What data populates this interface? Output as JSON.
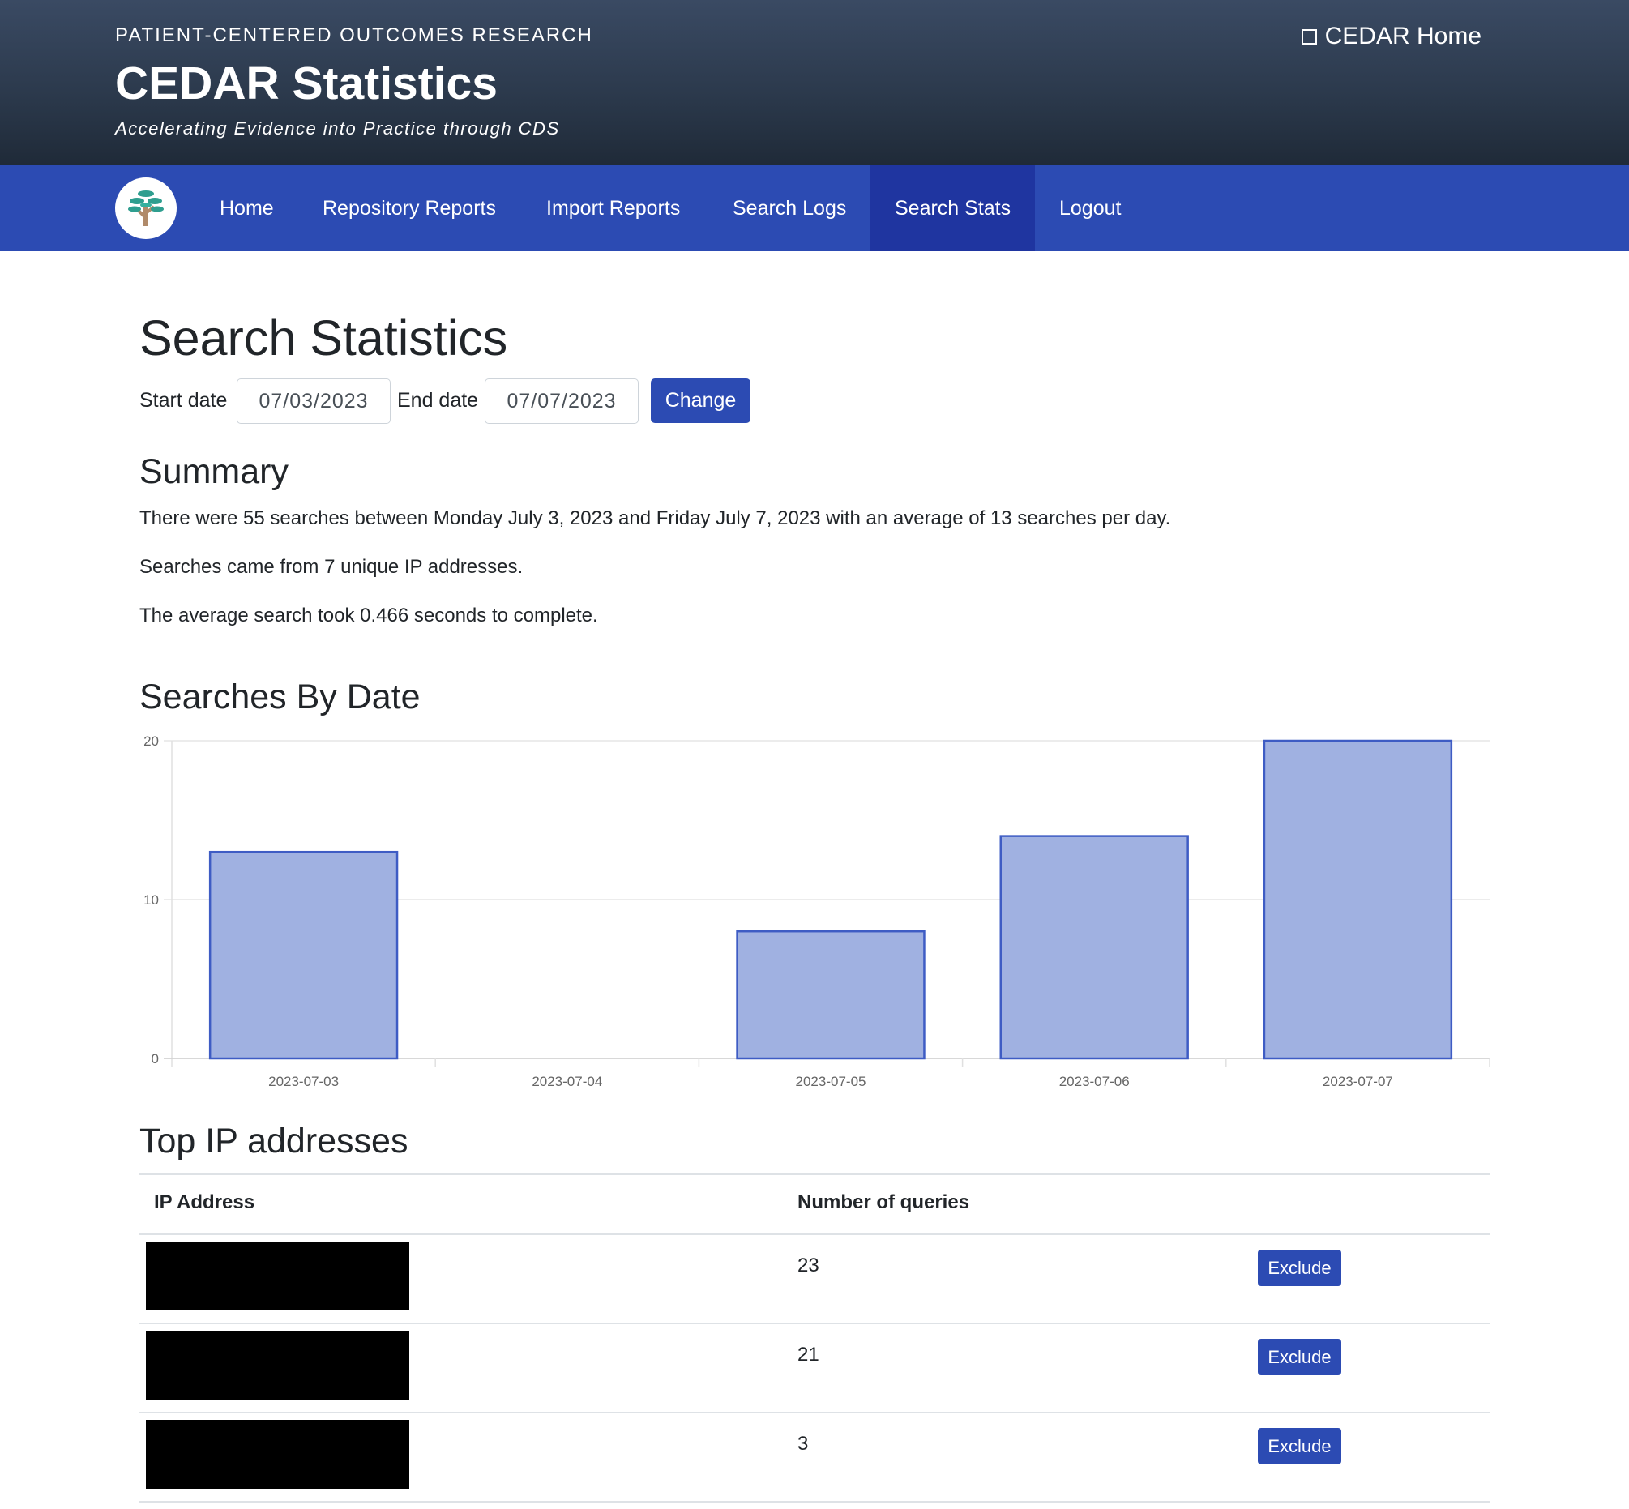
{
  "header": {
    "org": "PATIENT-CENTERED OUTCOMES RESEARCH",
    "title": "CEDAR Statistics",
    "tagline": "Accelerating Evidence into Practice through CDS",
    "home_link": "CEDAR Home",
    "home_icon": "square-icon"
  },
  "nav": {
    "logo_icon": "tree-logo-icon",
    "items": [
      {
        "label": "Home"
      },
      {
        "label": "Repository Reports"
      },
      {
        "label": "Import Reports"
      },
      {
        "label": "Search Logs"
      },
      {
        "label": "Search Stats",
        "active": true
      },
      {
        "label": "Logout"
      }
    ]
  },
  "page": {
    "title": "Search Statistics",
    "filters": {
      "start_label": "Start date",
      "start_value": "07/03/2023",
      "end_label": "End date",
      "end_value": "07/07/2023",
      "change_label": "Change"
    },
    "summary": {
      "heading": "Summary",
      "line1": "There were 55 searches between Monday July 3, 2023 and Friday July 7, 2023 with an average of 13 searches per day.",
      "line2": "Searches came from 7 unique IP addresses.",
      "line3": "The average search took 0.466 seconds to complete."
    },
    "chart_heading": "Searches By Date",
    "ip_section": {
      "heading": "Top IP addresses",
      "col_ip": "IP Address",
      "col_count": "Number of queries",
      "exclude_label": "Exclude",
      "rows": [
        {
          "count": "23"
        },
        {
          "count": "21"
        },
        {
          "count": "3"
        }
      ]
    }
  },
  "chart_data": {
    "type": "bar",
    "categories": [
      "2023-07-03",
      "2023-07-04",
      "2023-07-05",
      "2023-07-06",
      "2023-07-07"
    ],
    "values": [
      13,
      0,
      8,
      14,
      20
    ],
    "ylim": [
      0,
      20
    ],
    "yticks": [
      0,
      10,
      20
    ],
    "grid": true,
    "bar_fill": "#a0b1e1",
    "bar_stroke": "#3e5cc4"
  },
  "colors": {
    "nav_bg": "#2c4bb3",
    "nav_active": "#1f35a0",
    "button": "#2c4bb3"
  }
}
